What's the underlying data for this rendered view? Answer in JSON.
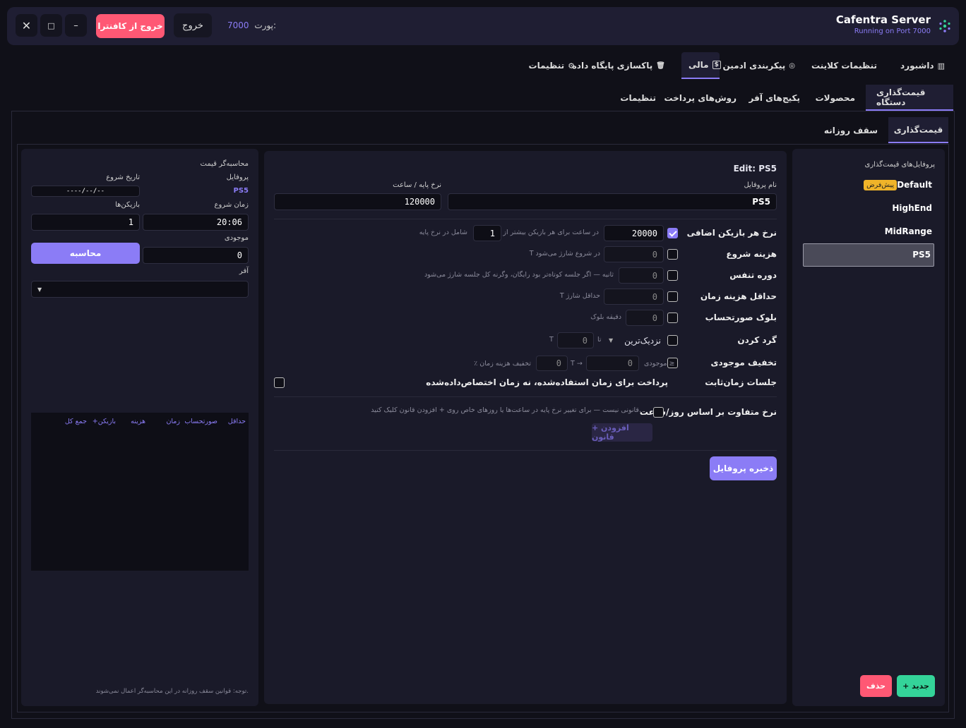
{
  "app": {
    "name": "Cafentra Server",
    "status": "Running on Port 7000",
    "port_label": "پورت:",
    "port_value": "7000",
    "exit_label": "خروج",
    "exit_cafentra_label": "خروج از کافنترا",
    "minimize": "–",
    "maximize": "□",
    "close": "✕"
  },
  "tabs": [
    {
      "label": "داشبورد",
      "icon": "chart-icon"
    },
    {
      "label": "تنظیمات کلاینت",
      "icon": ""
    },
    {
      "label": "پیکربندی ادمین",
      "icon": "shield-icon"
    },
    {
      "label": "مالی",
      "icon": "money-icon"
    },
    {
      "label": "پاکسازی پایگاه داده",
      "icon": "trash-icon"
    },
    {
      "label": "تنظیمات",
      "icon": "gear-icon"
    }
  ],
  "subtabs": [
    "قیمت‌گذاری دستگاه",
    "محصولات",
    "پکیج‌های آفر",
    "روش‌های پرداخت",
    "تنظیمات"
  ],
  "subsubtabs": [
    "قیمت‌گذاری",
    "سقف روزانه"
  ],
  "profiles": {
    "title": "پروفایل‌های قیمت‌گذاری",
    "items": [
      "Default",
      "HighEnd",
      "MidRange",
      "PS5"
    ],
    "default_badge": "پیش‌فرض",
    "new_button": "+ جدید",
    "delete_button": "حذف"
  },
  "editor": {
    "title": "Edit: PS5",
    "name_label": "نام پروفایل",
    "name_value": "PS5",
    "rate_label": "نرخ پایه / ساعت",
    "rate_value": "120000",
    "extra_player": {
      "label": "نرخ هر بازیکن اضافی",
      "value": "20000",
      "hint1": "T در ساعت برای هر بازیکن بیشتر از",
      "count": "1",
      "hint2": "شامل در نرخ پایه"
    },
    "start_fee": {
      "label": "هزینه شروع",
      "value": "0",
      "hint": "T در شروع شارژ می‌شود"
    },
    "grace": {
      "label": "دوره تنفس",
      "value": "0",
      "hint": "ثانیه — اگر جلسه کوتاه‌تر بود رایگان، وگرنه کل جلسه شارژ می‌شود"
    },
    "min_charge": {
      "label": "حداقل هزینه زمان",
      "value": "0",
      "hint": "T حداقل شارژ"
    },
    "block": {
      "label": "بلوک صورتحساب",
      "value": "0",
      "hint": "دقیقه بلوک"
    },
    "rounding": {
      "label": "گرد کردن",
      "mode": "نزدیک‌ترین",
      "to": "تا",
      "value": "0",
      "unit": "T"
    },
    "discount": {
      "label": "تخفیف موجودی",
      "bal_label": "موجودی ≥",
      "value1": "0",
      "arrow": "T →",
      "value2": "0",
      "hint": "٪ تخفیف هزینه زمان"
    },
    "fixed": {
      "label": "جلسات زمان‌ثابت",
      "desc": "پرداخت برای زمان استفاده‌شده، نه زمان اختصاص‌داده‌شده"
    },
    "variable": {
      "label": "نرخ متفاوت بر اساس روز/ساعت",
      "hint": "قانونی نیست — برای تغییر نرخ پایه در ساعت‌ها یا روزهای خاص روی + افزودن قانون کلیک کنید."
    },
    "add_rule": "+ افزودن قانون",
    "save": "ذخیره پروفایل"
  },
  "calculator": {
    "title": "محاسبه‌گر قیمت",
    "profile_label": "پروفایل",
    "profile_value": "PS5",
    "date_label": "تاریخ شروع",
    "date_value": "----/--/--",
    "time_label": "زمان شروع",
    "time_value": "20:06",
    "players_label": "بازیکن‌ها",
    "players_value": "1",
    "balance_label": "موجودی",
    "balance_value": "0",
    "calc_button": "محاسبه",
    "offer_label": "آفر",
    "offer_value": "",
    "columns": [
      "حداقل",
      "صورتحساب",
      "زمان",
      "هزینه",
      "+بازیکن",
      "جمع کل"
    ],
    "note": "توجه: قوانین سقف روزانه در این محاسبه‌گر اعمال نمی‌شوند."
  },
  "colors": {
    "accent": "#8b7cf6",
    "danger": "#ff5874",
    "success": "#34d399",
    "badge": "#f0b429"
  }
}
